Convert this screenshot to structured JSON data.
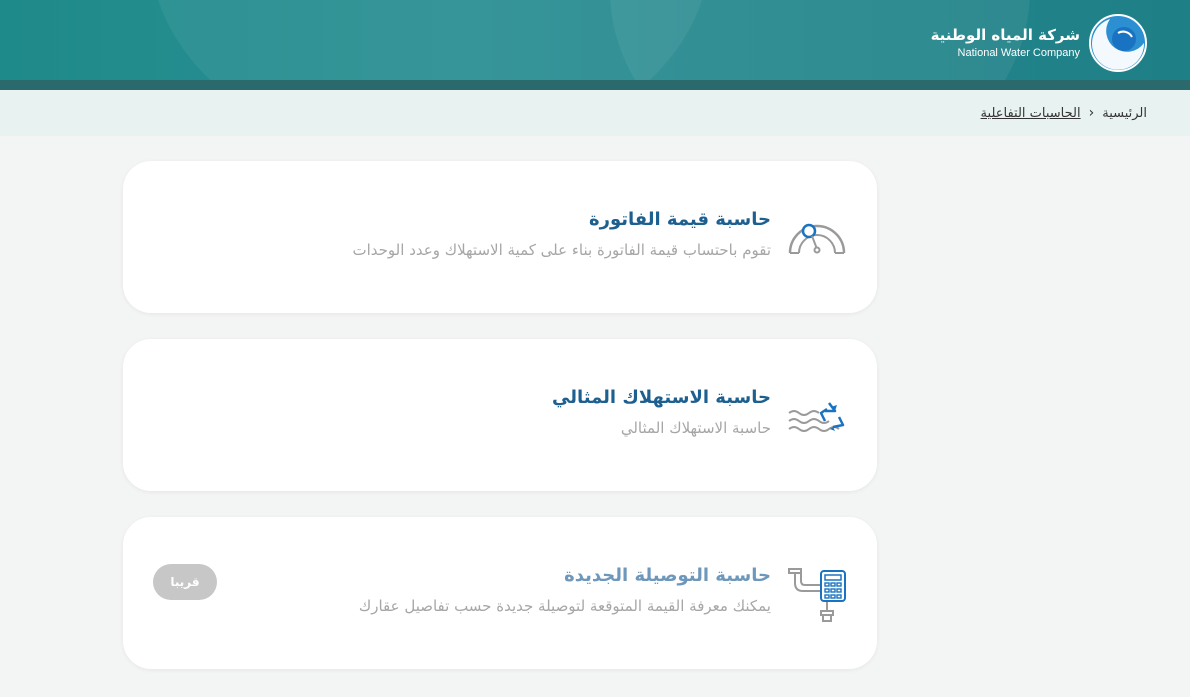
{
  "header": {
    "logo_ar": "شركة المياه الوطنية",
    "logo_en": "National Water Company"
  },
  "breadcrumb": {
    "home": "الرئيسية",
    "separator": "‹",
    "current": "الحاسبات التفاعلية"
  },
  "cards": [
    {
      "title": "حاسبة قيمة الفاتورة",
      "description": "تقوم باحتساب قيمة الفاتورة بناء على كمية الاستهلاك وعدد الوحدات",
      "icon": "gauge-icon"
    },
    {
      "title": "حاسبة الاستهلاك المثالي",
      "description": "حاسبة الاستهلاك المثالي",
      "icon": "recycle-water-icon"
    },
    {
      "title": "حاسبة التوصيلة الجديدة",
      "description": "يمكنك معرفة القيمة المتوقعة لتوصيلة جديدة حسب تفاصيل عقارك",
      "icon": "pipe-calculator-icon",
      "badge": "قريبا"
    }
  ],
  "colors": {
    "header": "#1f8a8a",
    "title": "#1d5f8f",
    "desc": "#a6a6a6",
    "icon_gray": "#9a9a9a",
    "icon_blue": "#1a73c2"
  }
}
